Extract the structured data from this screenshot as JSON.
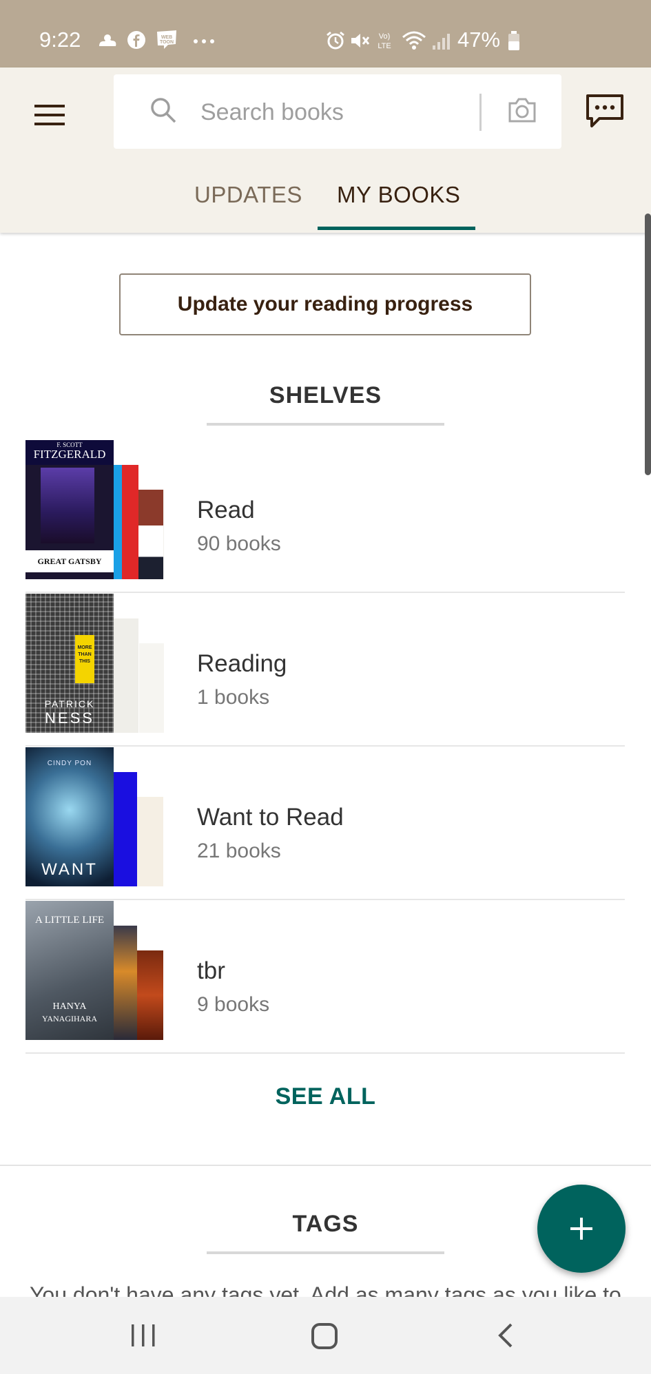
{
  "status_bar": {
    "time": "9:22",
    "battery_percent": "47%",
    "icons": [
      "weather-icon",
      "facebook-icon",
      "webtoon-icon",
      "more-dots-icon",
      "alarm-icon",
      "mute-icon",
      "volte-icon",
      "wifi-icon",
      "signal-icon",
      "battery-icon"
    ]
  },
  "header": {
    "menu_icon": "hamburger-menu-icon",
    "search_placeholder": "Search books",
    "camera_icon": "camera-icon",
    "chat_icon": "message-icon",
    "tabs": [
      {
        "label": "UPDATES",
        "active": false
      },
      {
        "label": "MY BOOKS",
        "active": true
      }
    ]
  },
  "main": {
    "update_progress_label": "Update your reading progress",
    "shelves_title": "SHELVES",
    "shelves": [
      {
        "name": "Read",
        "count": "90 books"
      },
      {
        "name": "Reading",
        "count": "1 books"
      },
      {
        "name": "Want to Read",
        "count": "21 books"
      },
      {
        "name": "tbr",
        "count": "9 books"
      }
    ],
    "see_all_label": "SEE ALL",
    "tags_title": "TAGS",
    "tags_empty_text": "You don't have any tags yet. Add as many tags as you like to",
    "covers": {
      "read": {
        "author": "F. SCOTT",
        "author2": "FITZGERALD",
        "title": "GREAT GATSBY"
      },
      "reading": {
        "author": "PATRICK",
        "author2": "NESS",
        "title": "MORE THAN THIS"
      },
      "want": {
        "author": "CINDY PON",
        "title": "WANT"
      },
      "tbr": {
        "title": "A LITTLE LIFE",
        "author": "HANYA",
        "author2": "YANAGIHARA"
      }
    }
  },
  "fab_icon": "plus-icon",
  "colors": {
    "status_bar": "#b8a994",
    "header_bg": "#f4f1ea",
    "accent": "#00635d",
    "text_dark": "#382110"
  },
  "nav": {
    "icons": [
      "recent-apps-icon",
      "home-icon",
      "back-icon"
    ]
  }
}
